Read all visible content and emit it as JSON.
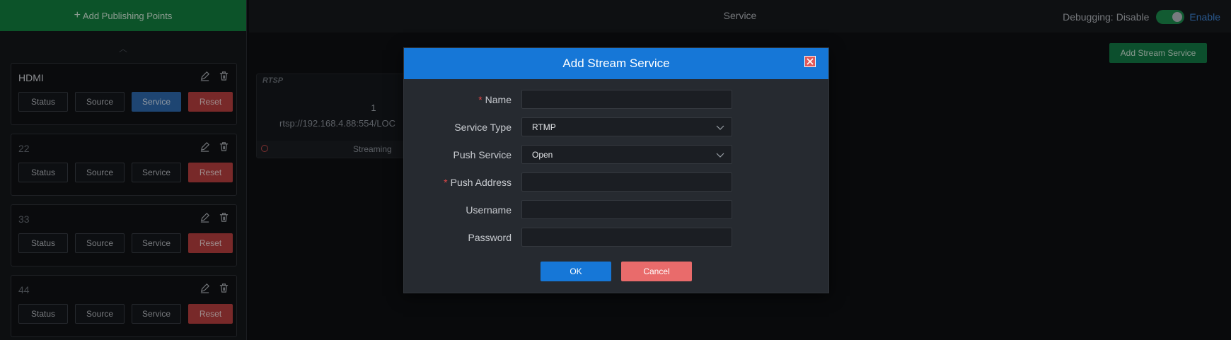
{
  "sidebar": {
    "add_label": "Add Publishing Points",
    "cards": [
      {
        "title": "HDMI",
        "buttons": [
          "Status",
          "Source",
          "Service",
          "Reset"
        ]
      },
      {
        "title": "22",
        "buttons": [
          "Status",
          "Source",
          "Service",
          "Reset"
        ]
      },
      {
        "title": "33",
        "buttons": [
          "Status",
          "Source",
          "Service",
          "Reset"
        ]
      },
      {
        "title": "44",
        "buttons": [
          "Status",
          "Source",
          "Service",
          "Reset"
        ]
      }
    ]
  },
  "header": {
    "title": "Service",
    "debug_label": "Debugging:",
    "debug_value": "Disable",
    "debug_enable": "Enable"
  },
  "main": {
    "add_stream_label": "Add Stream Service",
    "service_card": {
      "protocol": "RTSP",
      "number": "1",
      "url": "rtsp://192.168.4.88:554/LOC",
      "status": "Streaming"
    }
  },
  "modal": {
    "title": "Add Stream Service",
    "fields": {
      "name_label": "Name",
      "service_type_label": "Service Type",
      "service_type_value": "RTMP",
      "push_service_label": "Push Service",
      "push_service_value": "Open",
      "push_address_label": "Push Address",
      "username_label": "Username",
      "password_label": "Password"
    },
    "ok_label": "OK",
    "cancel_label": "Cancel"
  },
  "colors": {
    "accent_green": "#13803f",
    "accent_blue": "#1677d7",
    "danger": "#b84040"
  }
}
